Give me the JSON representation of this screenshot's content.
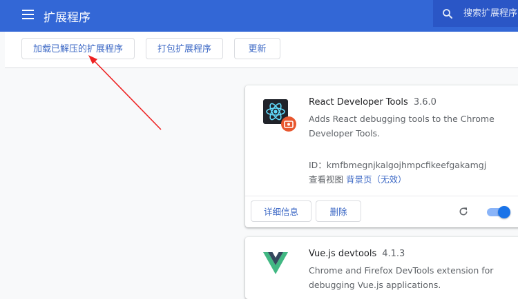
{
  "header": {
    "title": "扩展程序",
    "search_placeholder": "搜索扩展程序",
    "bg_color": "#3367d6"
  },
  "toolbar": {
    "load_unpacked_label": "加载已解压的扩展程序",
    "pack_label": "打包扩展程序",
    "update_label": "更新"
  },
  "extensions": [
    {
      "name": "React Developer Tools",
      "version": "3.6.0",
      "description": "Adds React debugging tools to the Chrome Developer Tools.",
      "id_text": "ID：kmfbmegnjkalgojhmpcfikeefgakamgj",
      "views_label": "查看视图",
      "views_link": "背景页（无效）",
      "details_label": "详细信息",
      "remove_label": "删除",
      "enabled": true,
      "icon": "react-icon"
    },
    {
      "name": "Vue.js devtools",
      "version": "4.1.3",
      "description": "Chrome and Firefox DevTools extension for debugging Vue.js applications.",
      "icon": "vue-icon"
    }
  ]
}
